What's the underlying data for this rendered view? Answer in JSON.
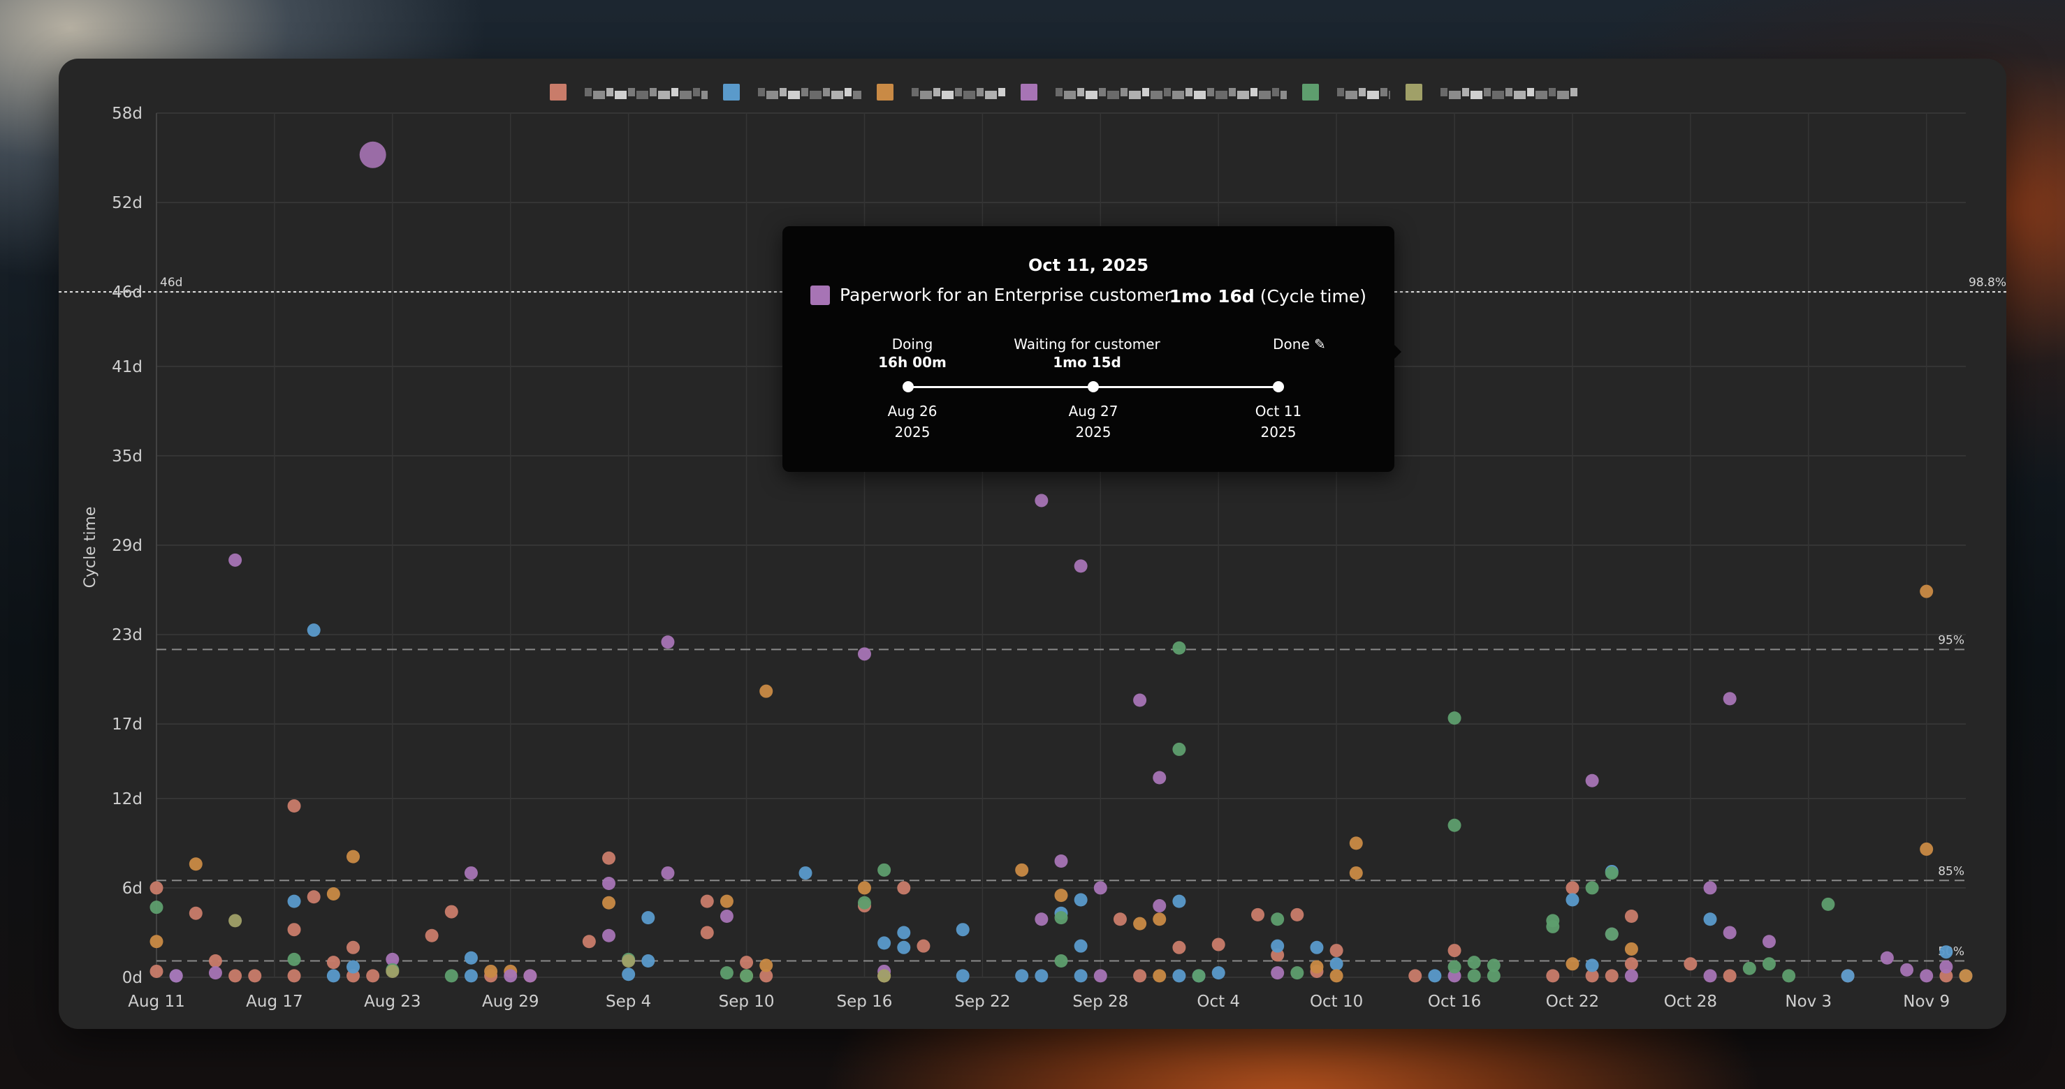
{
  "chart_data": {
    "type": "scatter",
    "ylabel": "Cycle time",
    "y_ticks": [
      "0d",
      "6d",
      "12d",
      "17d",
      "23d",
      "29d",
      "35d",
      "41d",
      "46d",
      "52d",
      "58d"
    ],
    "x_ticks": [
      "Aug 11",
      "Aug 17",
      "Aug 23",
      "Aug 29",
      "Sep 4",
      "Sep 10",
      "Sep 16",
      "Sep 22",
      "Sep 28",
      "Oct 4",
      "Oct 10",
      "Oct 16",
      "Oct 22",
      "Oct 28",
      "Nov 3",
      "Nov 9"
    ],
    "xlim": [
      "2025-08-11",
      "2025-11-11"
    ],
    "ylim_days": [
      0,
      58
    ],
    "grid": true,
    "legend_position": "top-center",
    "reference_lines": [
      {
        "label": "98.8%",
        "value_days": 46,
        "value_label": "46d"
      },
      {
        "label": "95%",
        "value_days": 22
      },
      {
        "label": "85%",
        "value_days": 6.5
      },
      {
        "label": "50%",
        "value_days": 1.1
      }
    ],
    "series": [
      {
        "color": "#c97c6a",
        "points": [
          [
            "2025-08-11",
            0.4
          ],
          [
            "2025-08-11",
            6.0
          ],
          [
            "2025-08-12",
            0.1
          ],
          [
            "2025-08-13",
            4.3
          ],
          [
            "2025-08-14",
            1.1
          ],
          [
            "2025-08-15",
            0.1
          ],
          [
            "2025-08-16",
            0.1
          ],
          [
            "2025-08-18",
            11.5
          ],
          [
            "2025-08-18",
            3.2
          ],
          [
            "2025-08-18",
            0.1
          ],
          [
            "2025-08-19",
            5.4
          ],
          [
            "2025-08-20",
            1.0
          ],
          [
            "2025-08-21",
            0.1
          ],
          [
            "2025-08-21",
            2.0
          ],
          [
            "2025-08-22",
            0.1
          ],
          [
            "2025-08-25",
            2.8
          ],
          [
            "2025-08-26",
            4.4
          ],
          [
            "2025-08-28",
            0.1
          ],
          [
            "2025-08-30",
            0.1
          ],
          [
            "2025-09-02",
            2.4
          ],
          [
            "2025-09-03",
            8.0
          ],
          [
            "2025-09-08",
            5.1
          ],
          [
            "2025-09-08",
            3.0
          ],
          [
            "2025-09-10",
            1.0
          ],
          [
            "2025-09-11",
            0.1
          ],
          [
            "2025-09-16",
            4.8
          ],
          [
            "2025-09-17",
            0.1
          ],
          [
            "2025-09-18",
            6.0
          ],
          [
            "2025-09-19",
            2.1
          ],
          [
            "2025-09-29",
            3.9
          ],
          [
            "2025-09-30",
            0.1
          ],
          [
            "2025-10-02",
            2.0
          ],
          [
            "2025-10-04",
            2.2
          ],
          [
            "2025-10-06",
            4.2
          ],
          [
            "2025-10-07",
            1.5
          ],
          [
            "2025-10-08",
            4.2
          ],
          [
            "2025-10-09",
            0.4
          ],
          [
            "2025-10-10",
            1.8
          ],
          [
            "2025-10-14",
            0.1
          ],
          [
            "2025-10-16",
            1.8
          ],
          [
            "2025-10-21",
            0.1
          ],
          [
            "2025-10-22",
            6.0
          ],
          [
            "2025-10-23",
            0.1
          ],
          [
            "2025-10-24",
            0.1
          ],
          [
            "2025-10-25",
            4.1
          ],
          [
            "2025-10-25",
            0.9
          ],
          [
            "2025-10-28",
            0.9
          ],
          [
            "2025-10-30",
            0.1
          ],
          [
            "2025-11-05",
            0.1
          ],
          [
            "2025-11-10",
            0.1
          ]
        ]
      },
      {
        "color": "#5a9acb",
        "points": [
          [
            "2025-08-12",
            0.1
          ],
          [
            "2025-08-18",
            5.1
          ],
          [
            "2025-08-19",
            23.3
          ],
          [
            "2025-08-20",
            0.1
          ],
          [
            "2025-08-21",
            0.7
          ],
          [
            "2025-08-27",
            1.3
          ],
          [
            "2025-08-27",
            0.1
          ],
          [
            "2025-09-04",
            0.2
          ],
          [
            "2025-09-05",
            4.0
          ],
          [
            "2025-09-05",
            1.1
          ],
          [
            "2025-09-13",
            7.0
          ],
          [
            "2025-09-17",
            2.3
          ],
          [
            "2025-09-18",
            2.0
          ],
          [
            "2025-09-18",
            3.0
          ],
          [
            "2025-09-21",
            3.2
          ],
          [
            "2025-09-21",
            0.1
          ],
          [
            "2025-09-24",
            0.1
          ],
          [
            "2025-09-25",
            0.1
          ],
          [
            "2025-09-26",
            4.3
          ],
          [
            "2025-09-27",
            5.2
          ],
          [
            "2025-09-27",
            2.1
          ],
          [
            "2025-09-27",
            0.1
          ],
          [
            "2025-10-02",
            5.1
          ],
          [
            "2025-10-02",
            0.1
          ],
          [
            "2025-10-03",
            0.1
          ],
          [
            "2025-10-04",
            0.3
          ],
          [
            "2025-10-07",
            2.1
          ],
          [
            "2025-10-09",
            2.0
          ],
          [
            "2025-10-10",
            0.9
          ],
          [
            "2025-10-15",
            0.1
          ],
          [
            "2025-10-22",
            5.2
          ],
          [
            "2025-10-23",
            0.8
          ],
          [
            "2025-10-24",
            7.1
          ],
          [
            "2025-10-29",
            3.9
          ],
          [
            "2025-11-05",
            0.1
          ],
          [
            "2025-11-10",
            1.7
          ],
          [
            "2025-11-11",
            0.1
          ]
        ]
      },
      {
        "color": "#c98a45",
        "points": [
          [
            "2025-08-11",
            2.4
          ],
          [
            "2025-08-13",
            7.6
          ],
          [
            "2025-08-20",
            5.6
          ],
          [
            "2025-08-21",
            8.1
          ],
          [
            "2025-08-28",
            0.4
          ],
          [
            "2025-08-29",
            0.4
          ],
          [
            "2025-09-03",
            5.0
          ],
          [
            "2025-09-09",
            5.1
          ],
          [
            "2025-09-10",
            0.1
          ],
          [
            "2025-09-11",
            19.2
          ],
          [
            "2025-09-11",
            0.8
          ],
          [
            "2025-09-16",
            6.0
          ],
          [
            "2025-09-17",
            0.1
          ],
          [
            "2025-09-24",
            7.2
          ],
          [
            "2025-09-26",
            5.5
          ],
          [
            "2025-09-30",
            3.6
          ],
          [
            "2025-10-01",
            3.9
          ],
          [
            "2025-10-01",
            0.1
          ],
          [
            "2025-10-09",
            0.7
          ],
          [
            "2025-10-10",
            0.1
          ],
          [
            "2025-10-11",
            9.0
          ],
          [
            "2025-10-11",
            7.0
          ],
          [
            "2025-10-22",
            0.9
          ],
          [
            "2025-10-25",
            1.9
          ],
          [
            "2025-11-09",
            25.9
          ],
          [
            "2025-11-09",
            8.6
          ],
          [
            "2025-11-11",
            0.1
          ]
        ]
      },
      {
        "color": "#a774b5",
        "points": [
          [
            "2025-08-12",
            0.1
          ],
          [
            "2025-08-14",
            0.3
          ],
          [
            "2025-08-15",
            28.0
          ],
          [
            "2025-08-22",
            55.2
          ],
          [
            "2025-08-23",
            1.2
          ],
          [
            "2025-08-27",
            7.0
          ],
          [
            "2025-08-29",
            0.1
          ],
          [
            "2025-08-30",
            0.1
          ],
          [
            "2025-09-03",
            6.3
          ],
          [
            "2025-09-03",
            2.8
          ],
          [
            "2025-09-06",
            22.5
          ],
          [
            "2025-09-06",
            7.0
          ],
          [
            "2025-09-09",
            4.1
          ],
          [
            "2025-09-16",
            21.7
          ],
          [
            "2025-09-17",
            0.4
          ],
          [
            "2025-09-25",
            32.0
          ],
          [
            "2025-09-25",
            3.9
          ],
          [
            "2025-09-26",
            7.8
          ],
          [
            "2025-09-27",
            27.6
          ],
          [
            "2025-09-28",
            6.0
          ],
          [
            "2025-09-28",
            0.1
          ],
          [
            "2025-09-30",
            18.6
          ],
          [
            "2025-10-01",
            13.4
          ],
          [
            "2025-10-01",
            4.8
          ],
          [
            "2025-10-07",
            0.3
          ],
          [
            "2025-10-12",
            45.9
          ],
          [
            "2025-10-16",
            0.1
          ],
          [
            "2025-10-23",
            13.2
          ],
          [
            "2025-10-24",
            2.9
          ],
          [
            "2025-10-25",
            0.1
          ],
          [
            "2025-10-29",
            6.0
          ],
          [
            "2025-10-29",
            0.1
          ],
          [
            "2025-10-30",
            18.7
          ],
          [
            "2025-10-30",
            3.0
          ],
          [
            "2025-11-01",
            2.4
          ],
          [
            "2025-11-07",
            1.3
          ],
          [
            "2025-11-08",
            0.5
          ],
          [
            "2025-11-09",
            0.1
          ],
          [
            "2025-11-10",
            0.7
          ]
        ]
      },
      {
        "color": "#5e9e6e",
        "points": [
          [
            "2025-08-11",
            4.7
          ],
          [
            "2025-08-18",
            1.2
          ],
          [
            "2025-08-23",
            0.5
          ],
          [
            "2025-08-26",
            0.1
          ],
          [
            "2025-09-04",
            1.2
          ],
          [
            "2025-09-09",
            0.3
          ],
          [
            "2025-09-10",
            0.1
          ],
          [
            "2025-09-16",
            5.0
          ],
          [
            "2025-09-17",
            7.2
          ],
          [
            "2025-09-26",
            1.1
          ],
          [
            "2025-09-26",
            4.0
          ],
          [
            "2025-10-02",
            22.1
          ],
          [
            "2025-10-02",
            15.3
          ],
          [
            "2025-10-03",
            0.1
          ],
          [
            "2025-10-07",
            3.9
          ],
          [
            "2025-10-08",
            0.3
          ],
          [
            "2025-10-16",
            17.4
          ],
          [
            "2025-10-16",
            10.2
          ],
          [
            "2025-10-16",
            0.7
          ],
          [
            "2025-10-17",
            1.0
          ],
          [
            "2025-10-17",
            0.1
          ],
          [
            "2025-10-18",
            0.8
          ],
          [
            "2025-10-18",
            0.1
          ],
          [
            "2025-10-21",
            3.4
          ],
          [
            "2025-10-21",
            3.8
          ],
          [
            "2025-10-23",
            6.0
          ],
          [
            "2025-10-24",
            2.9
          ],
          [
            "2025-10-24",
            7.0
          ],
          [
            "2025-10-31",
            0.6
          ],
          [
            "2025-11-01",
            0.9
          ],
          [
            "2025-11-02",
            0.1
          ],
          [
            "2025-11-04",
            4.9
          ]
        ]
      },
      {
        "color": "#a0a068",
        "points": [
          [
            "2025-08-15",
            3.8
          ],
          [
            "2025-08-23",
            0.4
          ],
          [
            "2025-09-04",
            1.1
          ],
          [
            "2025-09-17",
            0.1
          ]
        ]
      }
    ]
  },
  "legend": {
    "swatch_colors": [
      "#c97c6a",
      "#5a9acb",
      "#c98a45",
      "#a774b5",
      "#5e9e6e",
      "#a0a068"
    ],
    "label_widths": [
      190,
      162,
      148,
      345,
      90,
      212
    ]
  },
  "tooltip": {
    "date": "Oct 11, 2025",
    "item": "Paperwork for an Enterprise customer",
    "value": "1mo 16d",
    "value_suffix": "(Cycle time)",
    "stages": [
      {
        "name": "Doing",
        "duration": "16h 00m",
        "start_date": "Aug 26",
        "start_year": "2025"
      },
      {
        "name": "Waiting for customer",
        "duration": "1mo 15d",
        "start_date": "Aug 27",
        "start_year": "2025"
      },
      {
        "name": "Done ✎",
        "duration": "",
        "start_date": "Oct 11",
        "start_year": "2025"
      }
    ]
  }
}
